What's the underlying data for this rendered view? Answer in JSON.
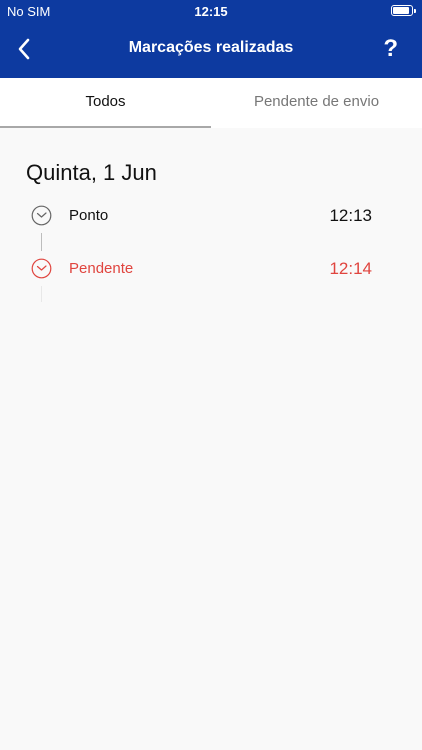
{
  "status_bar": {
    "carrier": "No SIM",
    "time": "12:15"
  },
  "nav": {
    "title": "Marcações realizadas",
    "help": "?",
    "back_icon": "chevron-left-icon"
  },
  "tabs": [
    {
      "label": "Todos",
      "active": true
    },
    {
      "label": "Pendente de envio",
      "active": false
    }
  ],
  "day": {
    "heading": "Quinta, 1 Jun",
    "entries": [
      {
        "label": "Ponto",
        "time": "12:13",
        "status": "ok",
        "icon": "clock-icon",
        "color": "#555555"
      },
      {
        "label": "Pendente",
        "time": "12:14",
        "status": "pending",
        "icon": "clock-icon",
        "color": "#e0453f"
      }
    ]
  },
  "colors": {
    "primary": "#0d3aa0",
    "pending": "#e0453f"
  }
}
